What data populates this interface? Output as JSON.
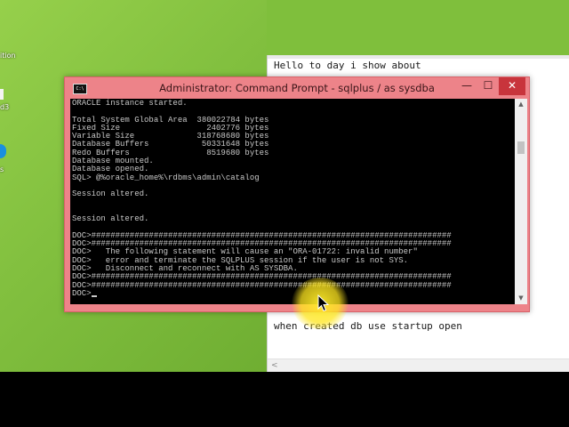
{
  "desktop": {
    "label_top": "ition",
    "label_mid": "d3",
    "label_low": "s"
  },
  "notepad": {
    "line_top": "Hello to day i show about",
    "line_bottom": "when created db use startup open",
    "scroll_left_arrow": "<"
  },
  "cmd": {
    "icon_text": "C:\\",
    "title": "Administrator: Command Prompt - sqlplus  / as sysdba",
    "btn_min": "—",
    "btn_max": "☐",
    "btn_close": "✕",
    "scroll_up": "▲",
    "scroll_down": "▼",
    "lines": [
      "ORACLE instance started.",
      "",
      "Total System Global Area  380022784 bytes",
      "Fixed Size                  2402776 bytes",
      "Variable Size             318768680 bytes",
      "Database Buffers           50331648 bytes",
      "Redo Buffers                8519680 bytes",
      "Database mounted.",
      "Database opened.",
      "SQL> @%oracle_home%\\rdbms\\admin\\catalog",
      "",
      "Session altered.",
      "",
      "",
      "Session altered.",
      "",
      "DOC>###########################################################################",
      "DOC>###########################################################################",
      "DOC>   The following statement will cause an \"ORA-01722: invalid number\"",
      "DOC>   error and terminate the SQLPLUS session if the user is not SYS.",
      "DOC>   Disconnect and reconnect with AS SYSDBA.",
      "DOC>###########################################################################",
      "DOC>###########################################################################",
      "DOC>"
    ]
  },
  "colors": {
    "desktop_green": "#82c03f",
    "titlebar_pink": "#ed8389",
    "close_red": "#c8343c",
    "console_text": "#c8c8c8",
    "highlight_yellow": "#ffe628"
  }
}
